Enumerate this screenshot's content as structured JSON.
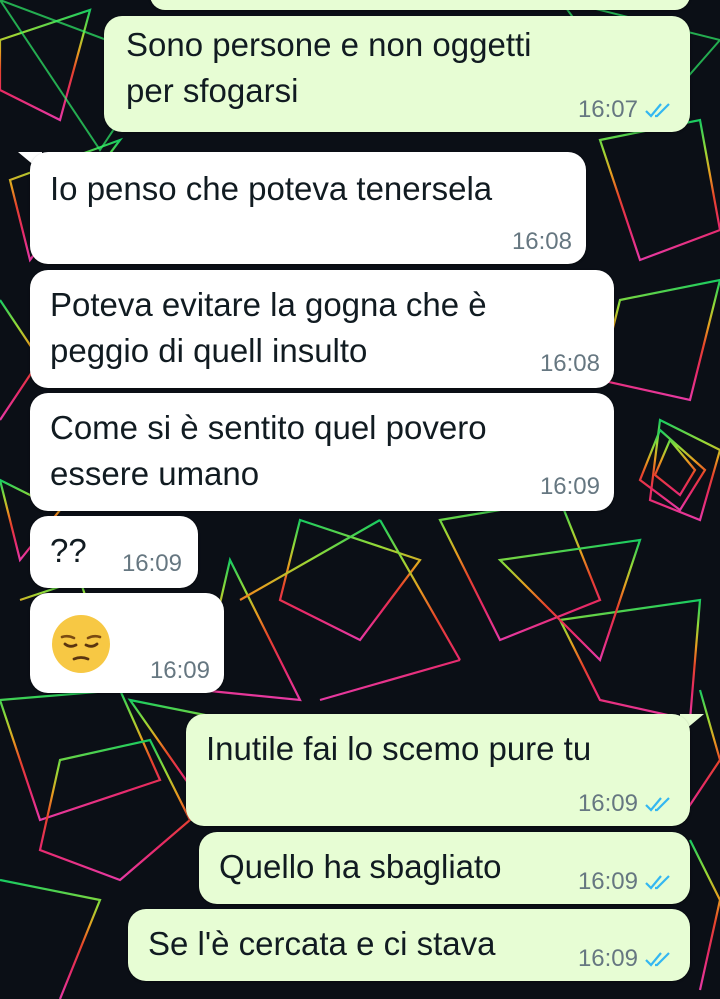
{
  "theme": {
    "incoming_bubble": "#ffffff",
    "outgoing_bubble": "#e7fdd4",
    "read_ticks": "#34b7f1",
    "timestamp_color": "#667781"
  },
  "messages": [
    {
      "id": "m1",
      "direction": "outgoing",
      "text": "Sono persone e non oggetti\nper sfogarsi",
      "time": "16:07",
      "status": "read-ticks-icon"
    },
    {
      "id": "m2",
      "direction": "incoming",
      "text": "Io penso che poteva tenersela",
      "time": "16:08"
    },
    {
      "id": "m3",
      "direction": "incoming",
      "text": "Poteva evitare la gogna che è\npeggio di quell insulto",
      "time": "16:08"
    },
    {
      "id": "m4",
      "direction": "incoming",
      "text": "Come si è sentito quel povero\nessere umano",
      "time": "16:09"
    },
    {
      "id": "m5",
      "direction": "incoming",
      "text": "??",
      "time": "16:09"
    },
    {
      "id": "m6",
      "direction": "incoming",
      "emoji": "pensive-face-emoji",
      "time": "16:09"
    },
    {
      "id": "m7",
      "direction": "outgoing",
      "text": "Inutile fai lo scemo pure tu",
      "time": "16:09",
      "status": "read-ticks-icon"
    },
    {
      "id": "m8",
      "direction": "outgoing",
      "text": "Quello ha sbagliato",
      "time": "16:09",
      "status": "read-ticks-icon"
    },
    {
      "id": "m9",
      "direction": "outgoing",
      "text": "Se l'è cercata e ci stava",
      "time": "16:09",
      "status": "read-ticks-icon"
    }
  ]
}
